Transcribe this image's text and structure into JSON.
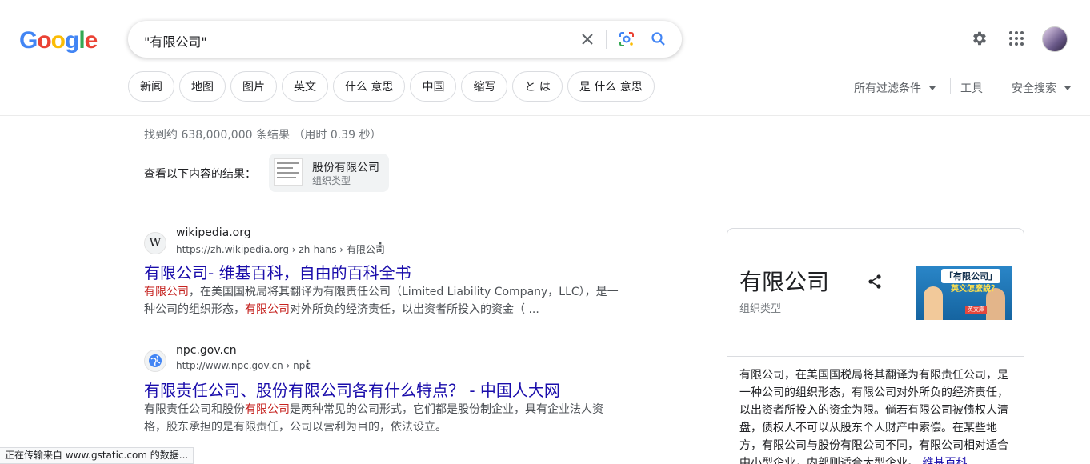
{
  "brand": {
    "logo_letters": [
      {
        "ch": "G",
        "color": "#4285f4"
      },
      {
        "ch": "o",
        "color": "#ea4335"
      },
      {
        "ch": "o",
        "color": "#fbbc05"
      },
      {
        "ch": "g",
        "color": "#4285f4"
      },
      {
        "ch": "l",
        "color": "#34a853"
      },
      {
        "ch": "e",
        "color": "#ea4335"
      }
    ]
  },
  "search": {
    "query": "\"有限公司\"",
    "clear_icon": "close-icon",
    "lens_icon": "google-lens-icon",
    "search_icon": "search-icon"
  },
  "header_icons": [
    "settings-gear-icon",
    "apps-grid-icon",
    "account-avatar"
  ],
  "chips": [
    "新闻",
    "地图",
    "图片",
    "英文",
    "什么 意思",
    "中国",
    "缩写",
    "と は",
    "是 什么 意思"
  ],
  "tools": {
    "all_filters": "所有过滤条件",
    "tools": "工具",
    "safe_search": "安全搜索"
  },
  "stats": "找到约 638,000,000 条结果 （用时 0.39 秒）",
  "see_results_about": {
    "label": "查看以下内容的结果：",
    "entity_name": "股份有限公司",
    "entity_type": "组织类型"
  },
  "results": [
    {
      "favicon_text": "W",
      "site": "wikipedia.org",
      "cite": "https://zh.wikipedia.org › zh-hans › 有限公司",
      "title": "有限公司- 维基百科，自由的百科全书",
      "snippet_parts": [
        {
          "t": "有限公司",
          "em": true
        },
        {
          "t": "，在美国国税局将其翻译为有限责任公司（Limited Liability Company，LLC），是一种公司的组织形态，",
          "em": false
        },
        {
          "t": "有限公司",
          "em": true
        },
        {
          "t": "对外所负的经济责任，以出资者所投入的资金（ ...",
          "em": false
        }
      ]
    },
    {
      "favicon_text": "",
      "site": "npc.gov.cn",
      "cite": "http://www.npc.gov.cn › npc",
      "title": "有限责任公司、股份有限公司各有什么特点？ - 中国人大网",
      "snippet_parts": [
        {
          "t": "有限责任公司和股份",
          "em": false
        },
        {
          "t": "有限公司",
          "em": true
        },
        {
          "t": "是两种常见的公司形式，它们都是股份制企业，具有企业法人资格，股东承担的是有限责任，公司以营利为目的，依法设立。",
          "em": false
        }
      ]
    }
  ],
  "knowledge_panel": {
    "title": "有限公司",
    "subtitle": "组织类型",
    "share_icon": "share-icon",
    "image_bubble": "「有限公司」",
    "image_sub": "英文怎麼說？",
    "image_tag": "英文庫",
    "description": "有限公司，在美国国税局将其翻译为有限责任公司，是一种公司的组织形态，有限公司对外所负的经济责任，以出资者所投入的资金为限。倘若有限公司被债权人清盘，债权人不可以从股东个人财产中索偿。在某些地方，有限公司与股份有限公司不同，有限公司相对适合中小型企业，内部则适合大型企业。",
    "more": "维基百科"
  },
  "status_bar": "正在传输来自 www.gstatic.com 的数据..."
}
